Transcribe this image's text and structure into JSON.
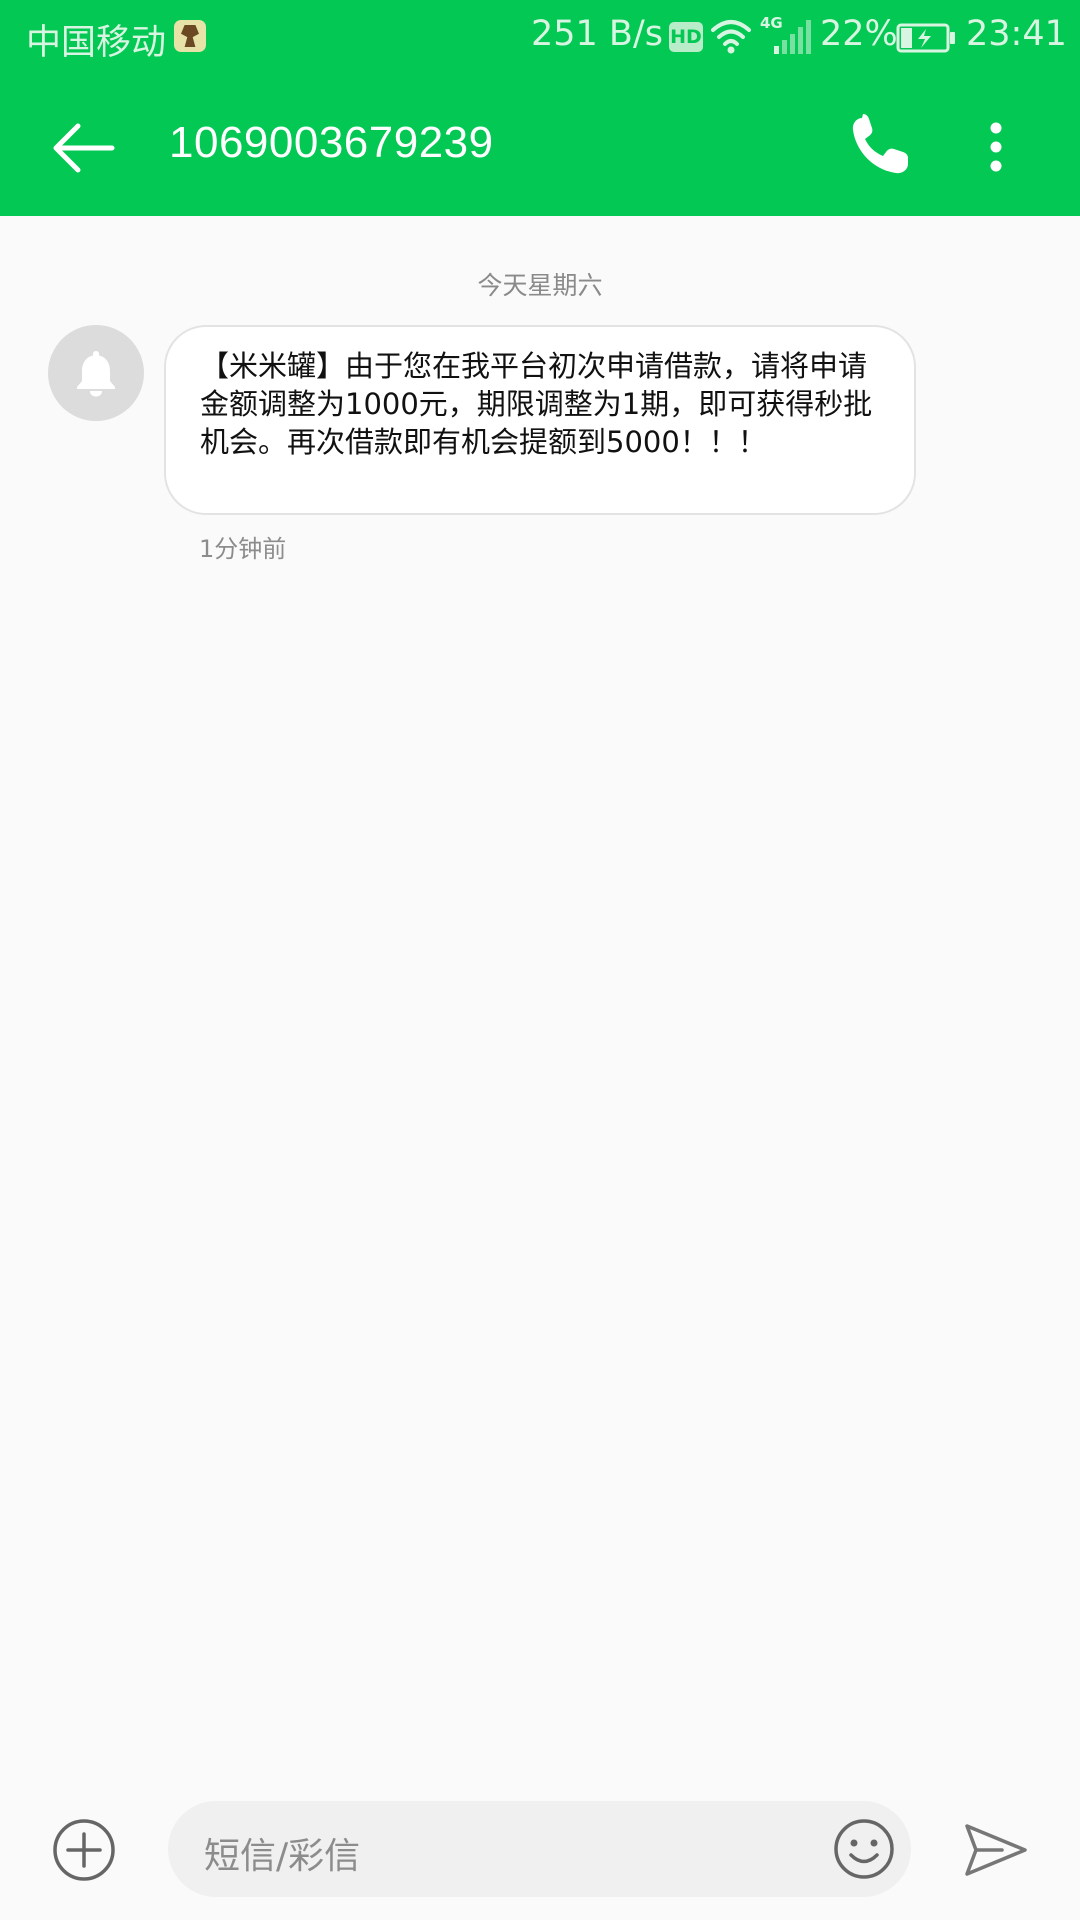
{
  "status_bar": {
    "carrier": "中国移动",
    "carrier_app_icon": "download-badge-icon",
    "net_speed": "251 B/s",
    "hd_badge": "HD",
    "lte_label": "4G",
    "battery_percent": "22%",
    "time": "23:41",
    "icons": [
      "wifi-icon",
      "signal-icon",
      "battery-charging-icon"
    ]
  },
  "app_bar": {
    "title": "1069003679239",
    "back_icon": "arrow-left-icon",
    "call_icon": "phone-icon",
    "more_icon": "more-vertical-icon",
    "color": "#03c853"
  },
  "conversation": {
    "date_divider": "今天星期六",
    "messages": [
      {
        "avatar_icon": "bell-icon",
        "text": "【米米罐】由于您在我平台初次申请借款，请将申请金额调整为1000元，期限调整为1期，即可获得秒批机会。再次借款即有机会提额到5000！！！",
        "time": "1分钟前"
      }
    ]
  },
  "compose": {
    "placeholder": "短信/彩信",
    "add_icon": "plus-circle-icon",
    "emoji_icon": "emoji-icon",
    "send_icon": "send-icon"
  }
}
